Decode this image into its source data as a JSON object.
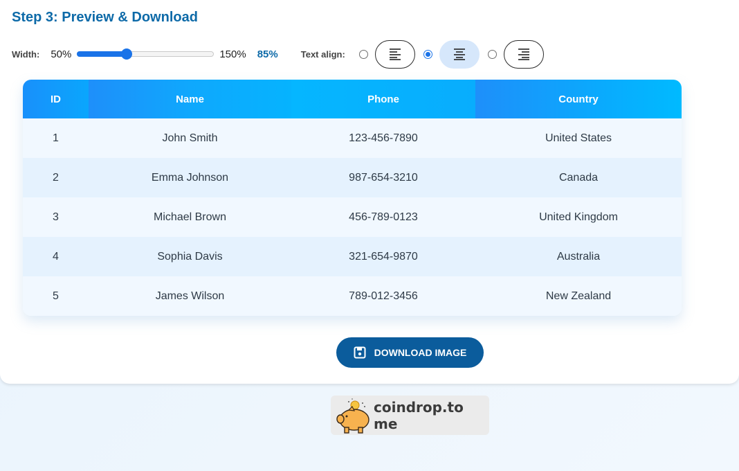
{
  "step": {
    "title": "Step 3: Preview & Download"
  },
  "controls": {
    "width_label": "Width:",
    "width_min": "50%",
    "width_max": "150%",
    "width_value": "85%",
    "width_percent": 85,
    "align_label": "Text align:",
    "align_options": [
      {
        "name": "left",
        "icon": "align-left-icon",
        "selected": false
      },
      {
        "name": "center",
        "icon": "align-center-icon",
        "selected": true
      },
      {
        "name": "right",
        "icon": "align-right-icon",
        "selected": false
      }
    ]
  },
  "table": {
    "headers": [
      "ID",
      "Name",
      "Phone",
      "Country"
    ],
    "rows": [
      [
        "1",
        "John Smith",
        "123-456-7890",
        "United States"
      ],
      [
        "2",
        "Emma Johnson",
        "987-654-3210",
        "Canada"
      ],
      [
        "3",
        "Michael Brown",
        "456-789-0123",
        "United Kingdom"
      ],
      [
        "4",
        "Sophia Davis",
        "321-654-9870",
        "Australia"
      ],
      [
        "5",
        "James Wilson",
        "789-012-3456",
        "New Zealand"
      ]
    ]
  },
  "download": {
    "label": "DOWNLOAD IMAGE",
    "icon": "save-icon"
  },
  "footer": {
    "badge_text": "coindrop.to me",
    "badge_icon": "piggy-bank-icon"
  },
  "colors": {
    "accent": "#1a73e8",
    "title": "#0d6aa8",
    "button": "#0b5c9c",
    "header_gradient_start": "#1e8ffa",
    "header_gradient_end": "#00baff"
  }
}
